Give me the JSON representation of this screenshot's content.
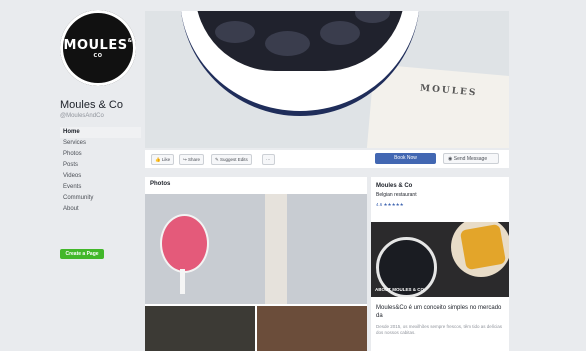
{
  "page": {
    "logo_text": "MOULES",
    "logo_sup": "& CO",
    "name": "Moules & Co",
    "handle": "@MoulesAndCo",
    "create_page": "Create a Page"
  },
  "nav": [
    "Home",
    "Services",
    "Photos",
    "Posts",
    "Videos",
    "Events",
    "Community",
    "About"
  ],
  "cover": {
    "menu_text": "MOULES"
  },
  "actions": {
    "like": "Like",
    "share": "Share",
    "suggest": "Suggest Edits",
    "more": "···",
    "book": "Book Now",
    "message": "Send Message"
  },
  "photos": {
    "title": "Photos"
  },
  "info": {
    "name": "Moules & Co",
    "category": "Belgian restaurant",
    "rating": "4.6 ★★★★★",
    "about_label": "ABOUT MOULES & CO",
    "desc_main": "Moules&Co é um conceito simples no mercado da",
    "desc_sub": "Desde 2015, os mexilhões sempre frescos, têm tido as delícias dos nossos cabitas."
  }
}
